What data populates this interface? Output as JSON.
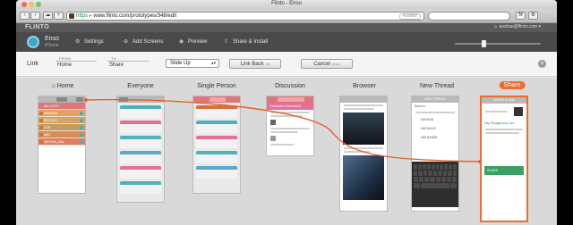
{
  "window": {
    "title": "Flinto - Enso"
  },
  "browser": {
    "url": "www.flinto.com/prototypes/348/edit",
    "url_prefix": "https",
    "reader_label": "Reader"
  },
  "app": {
    "brand": "FLINTO",
    "user_email": "aushas@flinto.com"
  },
  "project": {
    "name": "Enso",
    "platform": "iPhone",
    "actions": [
      {
        "label": "Settings",
        "icon": "gear-icon"
      },
      {
        "label": "Add Screens",
        "icon": "plus-icon"
      },
      {
        "label": "Preview",
        "icon": "eye-icon"
      },
      {
        "label": "Share & Install",
        "icon": "share-icon"
      }
    ]
  },
  "linkbar": {
    "title": "Link",
    "from_caption": "FROM",
    "from_value": "Home",
    "to_caption": "TO",
    "to_value": "Share",
    "transition": "Slide Up",
    "link_back_label": "Link Back",
    "link_back_key": "(b)",
    "cancel_label": "Cancel",
    "cancel_key": "(esc)"
  },
  "columns": [
    {
      "label": "Home",
      "icon": "home-icon"
    },
    {
      "label": "Everyone"
    },
    {
      "label": "Single Person"
    },
    {
      "label": "Discussion"
    },
    {
      "label": "Browser"
    },
    {
      "label": "New Thread"
    },
    {
      "label": "Share",
      "highlight": true
    }
  ],
  "screens": {
    "home": {
      "header": "ALL LISTS",
      "rows": [
        "AMANDA",
        "BROOKE",
        "ZOË",
        "MAZ",
        "NATHAN_BAZ"
      ]
    },
    "discussion": {
      "header": "Fieldnotes Submission"
    },
    "new_thread": {
      "header": "NEW THREAD",
      "send_label": "Send to",
      "names": [
        "NATHAN",
        "NATHALIE",
        "NATHANIEL"
      ]
    },
    "share": {
      "header": "SHARE A LINK",
      "link_text": "http://imagecoup.com",
      "share_button": "SHARE"
    }
  },
  "colors": {
    "accent_orange": "#f06b2f",
    "teal": "#4fb1b9",
    "pink": "#e36f9c",
    "flow_line": "#e0642c"
  }
}
